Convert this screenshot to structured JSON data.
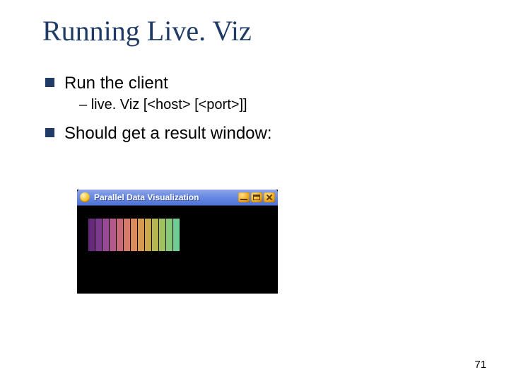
{
  "title": "Running Live. Viz",
  "bullets": {
    "b1": "Run the client",
    "b1_sub": "live. Viz [<host> [<port>]]",
    "b2": "Should get a result window:"
  },
  "window": {
    "title": "Parallel Data Visualization",
    "bar_colors": [
      "#652a7a",
      "#7c3a8f",
      "#974a95",
      "#b45a8a",
      "#c96a7b",
      "#d87a6b",
      "#dc8a5c",
      "#d79a50",
      "#c9a94c",
      "#b6b650",
      "#9fc160",
      "#86c978",
      "#6ecc94"
    ]
  },
  "page_number": "71"
}
